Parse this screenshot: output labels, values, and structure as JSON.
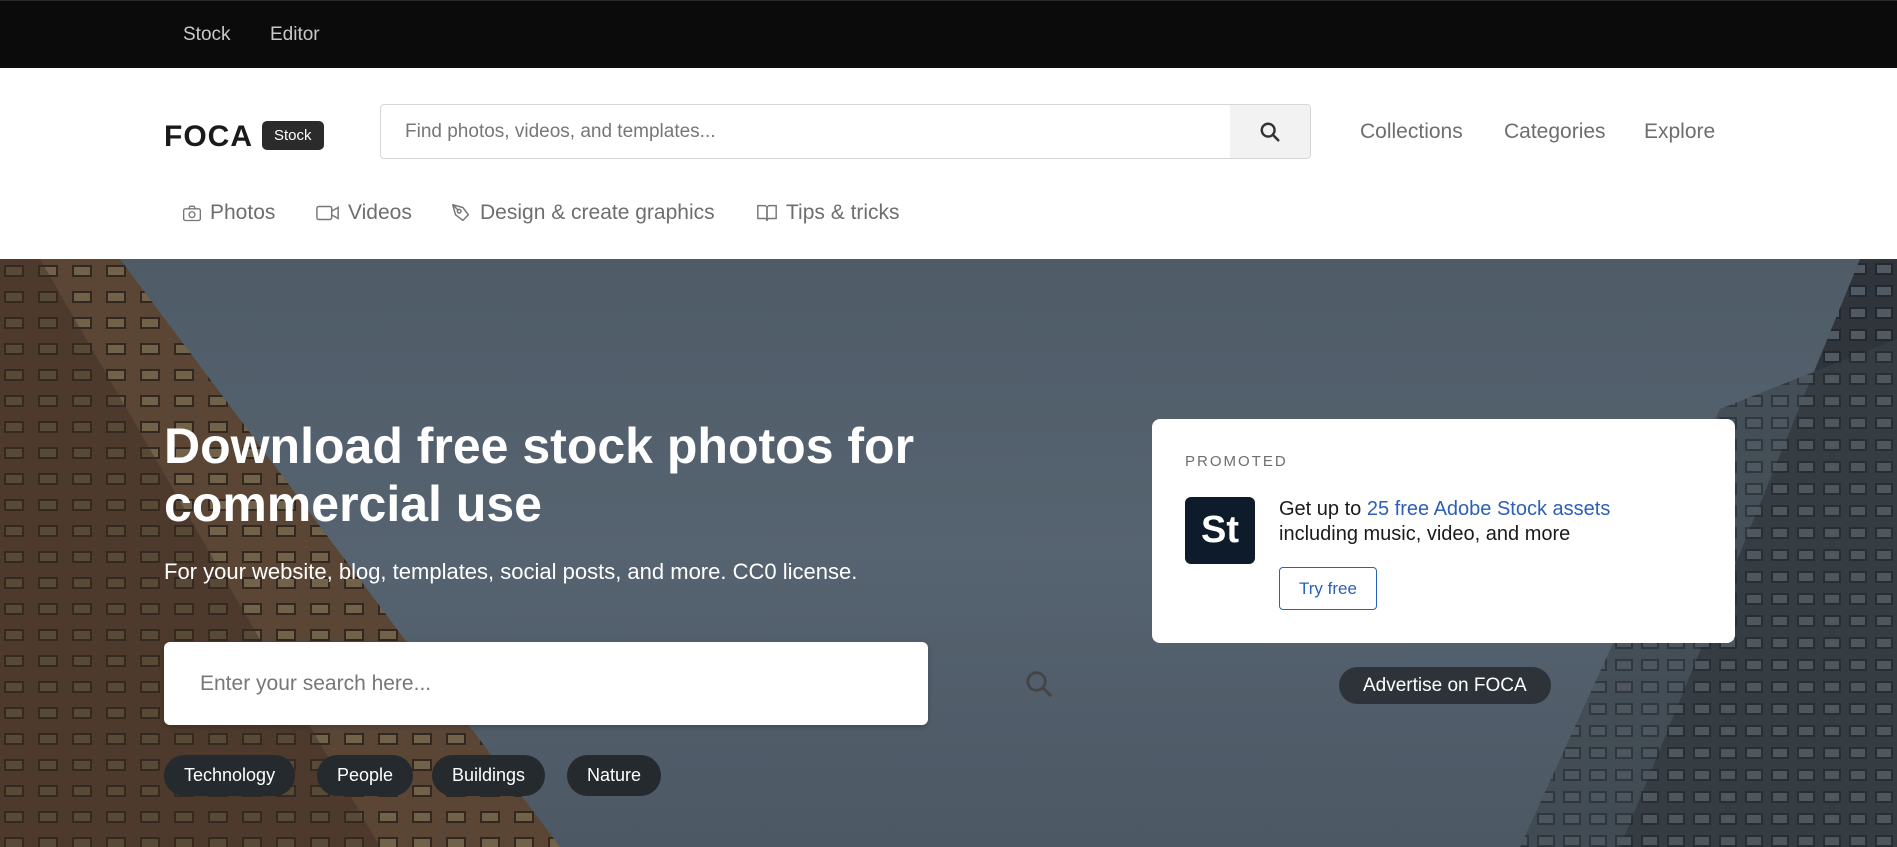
{
  "topbar": {
    "links": [
      "Stock",
      "Editor"
    ]
  },
  "header": {
    "logo": "FOCA",
    "logo_badge": "Stock",
    "search": {
      "placeholder": "Find photos, videos, and templates...",
      "icon": "search-icon"
    },
    "nav": [
      "Collections",
      "Categories",
      "Explore"
    ]
  },
  "subnav": [
    {
      "label": "Photos",
      "icon": "camera-icon"
    },
    {
      "label": "Videos",
      "icon": "video-camera-icon"
    },
    {
      "label": "Design & create graphics",
      "icon": "pen-tool-icon"
    },
    {
      "label": "Tips & tricks",
      "icon": "book-icon"
    }
  ],
  "hero": {
    "title_line1": "Download free stock photos for",
    "title_line2": "commercial use",
    "subtitle": "For your website, blog, templates, social posts, and more. CC0 license.",
    "search": {
      "placeholder": "Enter your search here...",
      "icon": "search-icon"
    },
    "tags": [
      "Technology",
      "People",
      "Buildings",
      "Nature"
    ]
  },
  "promo": {
    "label": "PROMOTED",
    "logo_text": "St",
    "text_prefix": "Get up to ",
    "link_text": "25 free Adobe Stock assets",
    "text_suffix": "including music, video, and more",
    "button": "Try free",
    "advertise": "Advertise on FOCA"
  },
  "colors": {
    "topbar_bg": "#0b0b0b",
    "link_blue": "#2c5fb7",
    "promo_logo_bg": "#0d1b2a"
  }
}
